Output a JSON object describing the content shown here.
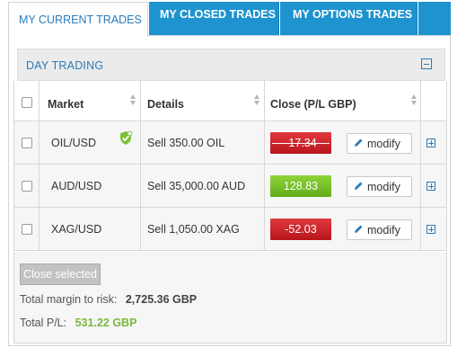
{
  "tabs": [
    {
      "label": "MY CURRENT TRADES",
      "active": true
    },
    {
      "label": "MY CLOSED TRADES",
      "active": false
    },
    {
      "label": "MY OPTIONS TRADES",
      "active": false
    }
  ],
  "section": {
    "title": "DAY TRADING"
  },
  "table": {
    "headers": {
      "market": "Market",
      "details": "Details",
      "close": "Close (P/L GBP)"
    },
    "rows": [
      {
        "market": "OIL/USD",
        "details": "Sell 350.00 OIL",
        "pl": "-17.34",
        "pl_status": "negative",
        "modify_label": "modify",
        "verified_icon": "shield-check-icon"
      },
      {
        "market": "AUD/USD",
        "details": "Sell 35,000.00 AUD",
        "pl": "128.83",
        "pl_status": "positive",
        "modify_label": "modify"
      },
      {
        "market": "XAG/USD",
        "details": "Sell 1,050.00 XAG",
        "pl": "-52.03",
        "pl_status": "negative",
        "modify_label": "modify"
      }
    ]
  },
  "footer": {
    "close_selected_label": "Close selected",
    "margin_label": "Total margin to risk:",
    "margin_value": "2,725.36 GBP",
    "pl_label": "Total P/L:",
    "pl_value": "531.22 GBP"
  },
  "colors": {
    "accent": "#2a7bb8",
    "tab_bg": "#1e93cf",
    "negative": "#c8232a",
    "positive": "#78c12a",
    "total_pl": "#7ab83f"
  }
}
